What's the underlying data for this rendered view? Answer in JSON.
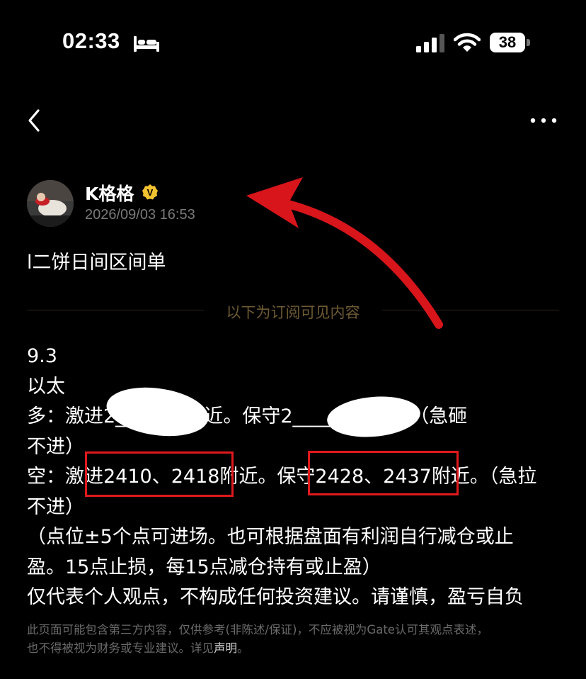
{
  "status_bar": {
    "time": "02:33",
    "battery": "38"
  },
  "author": {
    "name": "K格格",
    "verified_badge": "V",
    "post_time": "2026/09/03 16:53"
  },
  "post": {
    "title": "l二饼日间区间单",
    "divider_label": "以下为订阅可见内容",
    "lines": [
      "9.3",
      "以太",
      "多：激进2______8附近。保守2______6附近。（急砸",
      "不进）",
      "空：激进2410、2418附近。保守2428、2437附近。（急拉",
      "不进）",
      "（点位±5个点可进场。也可根据盘面有利润自行减仓或止",
      "盈。15点止损，每15点减仓持有或止盈）",
      "仅代表个人观点，不构成任何投资建议。请谨慎，盈亏自负"
    ]
  },
  "disclaimer": {
    "line1": "此页面可能包含第三方内容，仅供参考(非陈述/保证)，不应被视为Gate认可其观点表述，",
    "line2_text": "也不得被视为财务或专业建议。详见",
    "line2_link": "声明",
    "line2_end": "。"
  },
  "colors": {
    "accent_gold": "#f2c230",
    "annotation_red": "#e0191c",
    "divider_text": "#6e5a32"
  },
  "icons": [
    "sleep-bed-icon",
    "cellular-signal-icon",
    "wifi-icon",
    "battery-icon",
    "back-chevron-icon",
    "more-dots-icon",
    "verified-badge-icon"
  ]
}
